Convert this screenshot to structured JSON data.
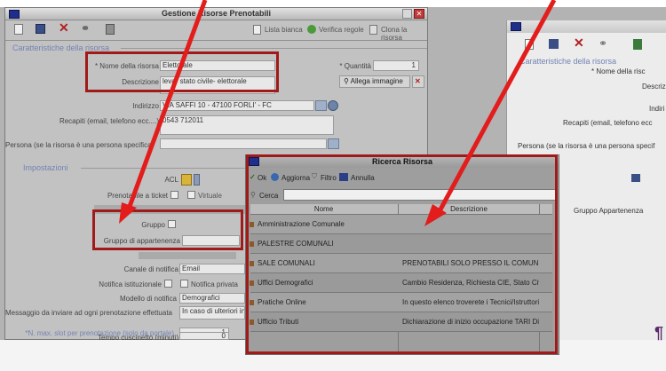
{
  "main_window": {
    "title": "Gestione Risorse Prenotabili",
    "toolbar": {
      "lista_bianca": "Lista bianca",
      "verifica_regole": "Verifica regole",
      "clona_risorsa": "Clona la risorsa"
    },
    "section_caratteristiche": "Caratteristiche della risorsa",
    "fields": {
      "nome_label": "* Nome della risorsa",
      "nome_value": "Elettorale",
      "quantita_label": "* Quantità",
      "quantita_value": "1",
      "descrizione_label": "Descrizione",
      "descrizione_value": "leva- stato civile- elettorale",
      "allega_immagine": "Allega immagine",
      "indirizzo_label": "Indirizzo",
      "indirizzo_value": "VIA SAFFI 10 - 47100 FORLI' - FC",
      "recapiti_label": "Recapiti (email, telefono ecc....)",
      "recapiti_value": "0543 712011",
      "persona_label": "Persona (se la risorsa è una persona specifica)"
    },
    "section_impostazioni": "Impostazioni",
    "settings": {
      "acl_label": "ACL",
      "prenotabile_ticket_label": "Prenotabile a ticket",
      "virtuale_label": "Virtuale",
      "gruppo_label": "Gruppo",
      "gruppo_appartenenza_label": "Gruppo di appartenenza",
      "canale_notifica_label": "Canale di notifica",
      "canale_notifica_value": "Email",
      "notifica_istituzionale_label": "Notifica istituzionale",
      "notifica_privata_label": "Notifica privata",
      "modello_notifica_label": "Modello di notifica",
      "modello_notifica_value": "Demografici",
      "messaggio_label": "Messaggio da inviare ad ogni prenotazione effettuata",
      "messaggio_value": "In caso di ulteriori inf",
      "max_slot_label": "*N. max. slot per prenotazione (solo da portale)",
      "max_slot_value": "1",
      "tempo_label": "Tempo cuscinetto (minuti)",
      "tempo_value": "0"
    }
  },
  "right_window": {
    "section": "Caratteristiche della risorsa",
    "nome_label": "* Nome della risc",
    "descrizione_label": "Descriz",
    "indirizzo_label": "Indiri",
    "recapiti_label": "Recapiti (email, telefono ecc",
    "persona_label": "Persona (se la risorsa è una persona specif",
    "gruppo_appartenenza_header": "Gruppo Appartenenza",
    "pilcrow": "¶"
  },
  "search_dialog": {
    "title": "Ricerca Risorsa",
    "toolbar": {
      "ok": "Ok",
      "aggiorna": "Aggiorna",
      "filtro": "Filtro",
      "annulla": "Annulla"
    },
    "cerca_label": "Cerca",
    "columns": [
      "Nome",
      "Descrizione"
    ],
    "rows": [
      {
        "nome": "Amministrazione Comunale",
        "descrizione": ""
      },
      {
        "nome": "PALESTRE COMUNALI",
        "descrizione": ""
      },
      {
        "nome": "SALE COMUNALI",
        "descrizione": "PRENOTABILI SOLO PRESSO IL COMUNE"
      },
      {
        "nome": "Uffici Demografici",
        "descrizione": "Cambio Residenza, Richiesta CIE, Stato Civile"
      },
      {
        "nome": "Pratiche Online",
        "descrizione": "In questo elenco troverete i Tecnici/Istruttori ch"
      },
      {
        "nome": "Ufficio Tributi",
        "descrizione": "Dichiarazione di inizio occupazione TARI Dichiara"
      }
    ]
  },
  "colors": {
    "highlight_border": "#a01a1a",
    "arrow": "#e31c1c",
    "section_text": "#7284b4"
  }
}
